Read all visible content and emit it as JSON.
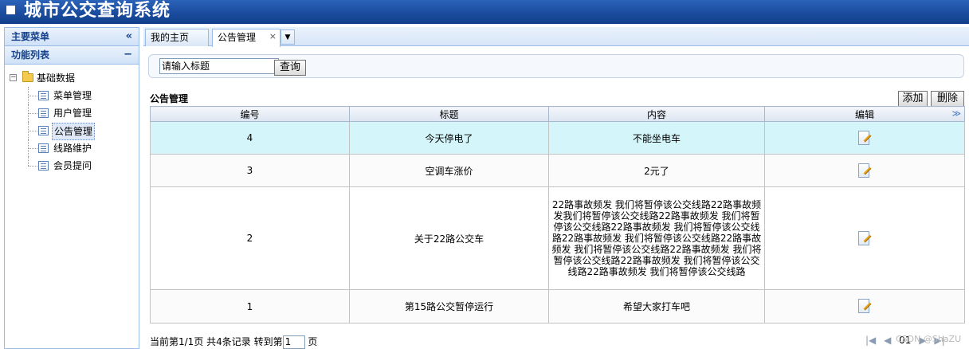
{
  "app": {
    "title": "城市公交查询系统"
  },
  "left_panel": {
    "main_menu_title": "主要菜单",
    "main_menu_collapse": "«",
    "func_list_title": "功能列表",
    "func_list_collapse": "−",
    "tree": {
      "root_toggle": "−",
      "root_label": "基础数据",
      "children": [
        "菜单管理",
        "用户管理",
        "公告管理",
        "线路维护",
        "会员提问"
      ],
      "selected": "公告管理"
    }
  },
  "tabs": {
    "home_label": "我的主页",
    "active_label": "公告管理",
    "close_glyph": "×",
    "more_glyph": "▼"
  },
  "search": {
    "input_value": "请输入标题",
    "button_label": "查询"
  },
  "section": {
    "title": "公告管理",
    "add_label": "添加",
    "delete_label": "删除"
  },
  "table": {
    "columns": [
      "编号",
      "标题",
      "内容",
      "编辑"
    ],
    "header_more_glyph": "≫",
    "rows": [
      {
        "id": "4",
        "title": "今天停电了",
        "content": "不能坐电车"
      },
      {
        "id": "3",
        "title": "空调车涨价",
        "content": "2元了"
      },
      {
        "id": "2",
        "title": "关于22路公交车",
        "content": "22路事故频发 我们将暂停该公交线路22路事故频发我们将暂停该公交线路22路事故频发 我们将暂停该公交线路22路事故频发 我们将暂停该公交线路22路事故频发 我们将暂停该公交线路22路事故频发 我们将暂停该公交线路22路事故频发 我们将暂停该公交线路22路事故频发 我们将暂停该公交线路22路事故频发 我们将暂停该公交线路"
      },
      {
        "id": "1",
        "title": "第15路公交暂停运行",
        "content": "希望大家打车吧"
      }
    ]
  },
  "pager": {
    "summary": "当前第1/1页 共4条记录 转到第",
    "goto_value": "1",
    "suffix": "页",
    "first_glyph": "|◀",
    "prev_glyph": "◀",
    "current": "01",
    "next_glyph": "▶",
    "last_glyph": "▶|"
  },
  "watermark": "CSDN @ShaZU"
}
